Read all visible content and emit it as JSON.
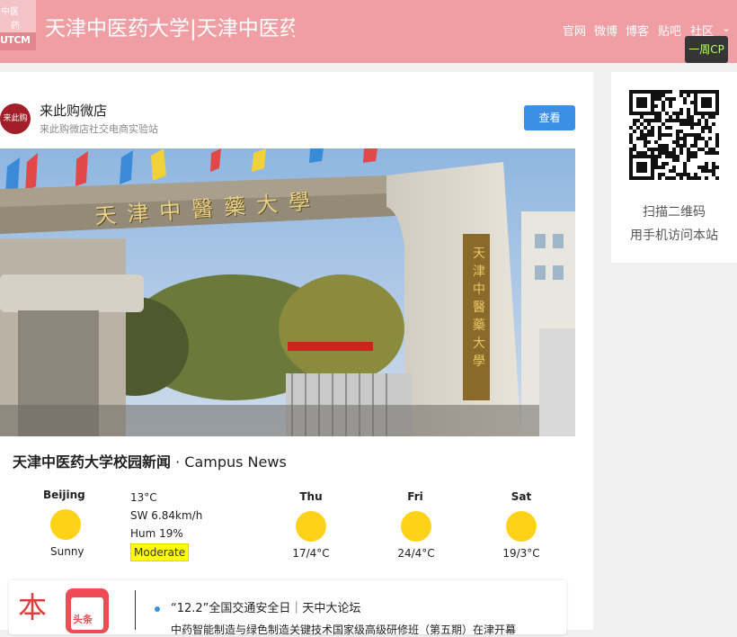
{
  "header": {
    "logo_lines": [
      "中医",
      "药",
      "UTCM"
    ],
    "site_title": "天津中医药大学|天津中医药大学",
    "nav": [
      "官网",
      "微博",
      "博客",
      "贴吧",
      "社区"
    ],
    "tooltip": "一周CP"
  },
  "store": {
    "avatar_label": "来此购",
    "name": "来此购微店",
    "subtitle": "来此购微店社交电商实验站",
    "view_button": "查看"
  },
  "photo": {
    "gate_inscription": "天津中醫藥大學",
    "vertical_plaque": "天津中醫藥大學"
  },
  "news_heading": {
    "bold": "天津中医药大学校园新闻",
    "suffix": " · Campus News"
  },
  "weather": {
    "city": "Beijing",
    "condition": "Sunny",
    "temp": "13°C",
    "wind": "SW 6.84km/h",
    "humidity": "Hum 19%",
    "aqi": "Moderate",
    "forecast": [
      {
        "day": "Thu",
        "temp": "17/4°C"
      },
      {
        "day": "Fri",
        "temp": "24/4°C"
      },
      {
        "day": "Sat",
        "temp": "19/3°C"
      }
    ]
  },
  "news": {
    "logo_char": "本",
    "logo_tag": "头条",
    "items": [
      "“12.2”全国交通安全日｜天中大论坛",
      "中药智能制造与绿色制造关键技术国家级高级研修班（第五期）在津开幕"
    ]
  },
  "qr": {
    "line1": "扫描二维码",
    "line2": "用手机访问本站"
  },
  "colors": {
    "header_bg": "#ef9ea3",
    "button_blue": "#3b8fe4",
    "sun": "#ffd21a",
    "aqi_badge": "#ffff00"
  }
}
